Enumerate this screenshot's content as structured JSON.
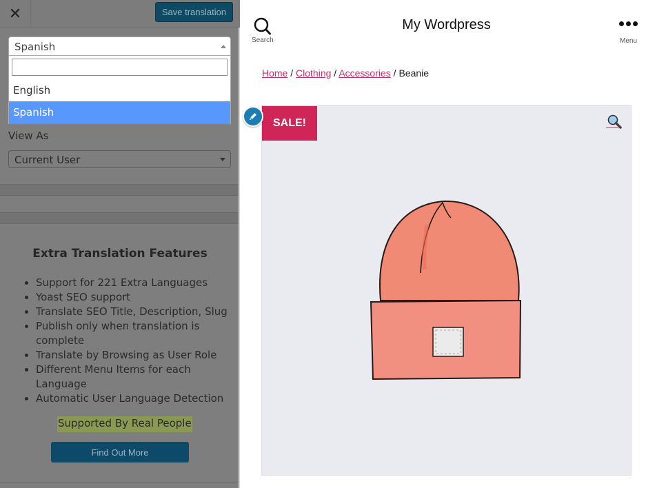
{
  "translator_panel": {
    "close_label": "✕",
    "save_button": "Save translation",
    "language_select": {
      "selected": "Spanish",
      "search_value": "",
      "options": [
        "English",
        "Spanish"
      ],
      "highlighted": "Spanish"
    },
    "view_as": {
      "label": "View As",
      "selected": "Current User"
    },
    "promo": {
      "title": "Extra Translation Features",
      "features": [
        "Support for 221 Extra Languages",
        "Yoast SEO support",
        "Translate SEO Title, Description, Slug",
        "Publish only when translation is complete",
        "Translate by Browsing as User Role",
        "Different Menu Items for each Language",
        "Automatic User Language Detection"
      ],
      "highlight": "Supported By Real People",
      "button": "Find Out More"
    }
  },
  "site": {
    "title": "My Wordpress",
    "search_label": "Search",
    "menu_label": "Menu",
    "breadcrumb": {
      "links": [
        "Home",
        "Clothing",
        "Accessories"
      ],
      "separator": "/",
      "current": "Beanie"
    },
    "product": {
      "badge": "SALE!",
      "image_alt": "Beanie",
      "accent_color": "#cf2557"
    }
  }
}
